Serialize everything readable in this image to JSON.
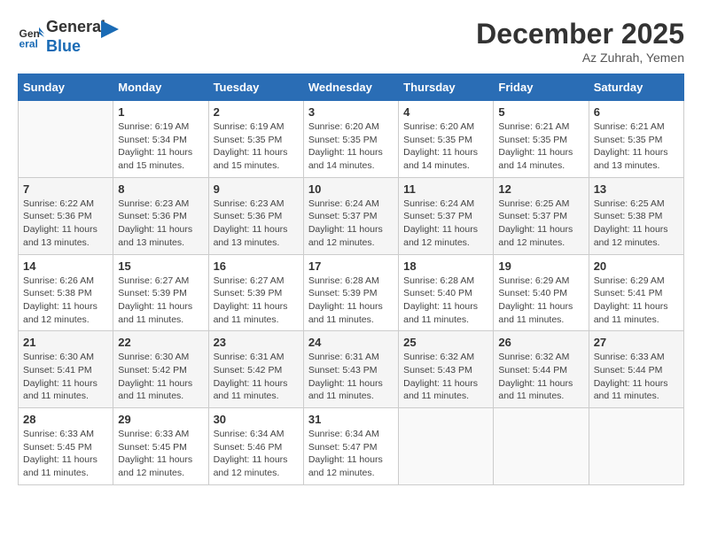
{
  "header": {
    "logo_line1": "General",
    "logo_line2": "Blue",
    "month_year": "December 2025",
    "location": "Az Zuhrah, Yemen"
  },
  "days_of_week": [
    "Sunday",
    "Monday",
    "Tuesday",
    "Wednesday",
    "Thursday",
    "Friday",
    "Saturday"
  ],
  "weeks": [
    [
      {
        "day": "",
        "info": ""
      },
      {
        "day": "1",
        "info": "Sunrise: 6:19 AM\nSunset: 5:34 PM\nDaylight: 11 hours and 15 minutes."
      },
      {
        "day": "2",
        "info": "Sunrise: 6:19 AM\nSunset: 5:35 PM\nDaylight: 11 hours and 15 minutes."
      },
      {
        "day": "3",
        "info": "Sunrise: 6:20 AM\nSunset: 5:35 PM\nDaylight: 11 hours and 14 minutes."
      },
      {
        "day": "4",
        "info": "Sunrise: 6:20 AM\nSunset: 5:35 PM\nDaylight: 11 hours and 14 minutes."
      },
      {
        "day": "5",
        "info": "Sunrise: 6:21 AM\nSunset: 5:35 PM\nDaylight: 11 hours and 14 minutes."
      },
      {
        "day": "6",
        "info": "Sunrise: 6:21 AM\nSunset: 5:35 PM\nDaylight: 11 hours and 13 minutes."
      }
    ],
    [
      {
        "day": "7",
        "info": "Sunrise: 6:22 AM\nSunset: 5:36 PM\nDaylight: 11 hours and 13 minutes."
      },
      {
        "day": "8",
        "info": "Sunrise: 6:23 AM\nSunset: 5:36 PM\nDaylight: 11 hours and 13 minutes."
      },
      {
        "day": "9",
        "info": "Sunrise: 6:23 AM\nSunset: 5:36 PM\nDaylight: 11 hours and 13 minutes."
      },
      {
        "day": "10",
        "info": "Sunrise: 6:24 AM\nSunset: 5:37 PM\nDaylight: 11 hours and 12 minutes."
      },
      {
        "day": "11",
        "info": "Sunrise: 6:24 AM\nSunset: 5:37 PM\nDaylight: 11 hours and 12 minutes."
      },
      {
        "day": "12",
        "info": "Sunrise: 6:25 AM\nSunset: 5:37 PM\nDaylight: 11 hours and 12 minutes."
      },
      {
        "day": "13",
        "info": "Sunrise: 6:25 AM\nSunset: 5:38 PM\nDaylight: 11 hours and 12 minutes."
      }
    ],
    [
      {
        "day": "14",
        "info": "Sunrise: 6:26 AM\nSunset: 5:38 PM\nDaylight: 11 hours and 12 minutes."
      },
      {
        "day": "15",
        "info": "Sunrise: 6:27 AM\nSunset: 5:39 PM\nDaylight: 11 hours and 11 minutes."
      },
      {
        "day": "16",
        "info": "Sunrise: 6:27 AM\nSunset: 5:39 PM\nDaylight: 11 hours and 11 minutes."
      },
      {
        "day": "17",
        "info": "Sunrise: 6:28 AM\nSunset: 5:39 PM\nDaylight: 11 hours and 11 minutes."
      },
      {
        "day": "18",
        "info": "Sunrise: 6:28 AM\nSunset: 5:40 PM\nDaylight: 11 hours and 11 minutes."
      },
      {
        "day": "19",
        "info": "Sunrise: 6:29 AM\nSunset: 5:40 PM\nDaylight: 11 hours and 11 minutes."
      },
      {
        "day": "20",
        "info": "Sunrise: 6:29 AM\nSunset: 5:41 PM\nDaylight: 11 hours and 11 minutes."
      }
    ],
    [
      {
        "day": "21",
        "info": "Sunrise: 6:30 AM\nSunset: 5:41 PM\nDaylight: 11 hours and 11 minutes."
      },
      {
        "day": "22",
        "info": "Sunrise: 6:30 AM\nSunset: 5:42 PM\nDaylight: 11 hours and 11 minutes."
      },
      {
        "day": "23",
        "info": "Sunrise: 6:31 AM\nSunset: 5:42 PM\nDaylight: 11 hours and 11 minutes."
      },
      {
        "day": "24",
        "info": "Sunrise: 6:31 AM\nSunset: 5:43 PM\nDaylight: 11 hours and 11 minutes."
      },
      {
        "day": "25",
        "info": "Sunrise: 6:32 AM\nSunset: 5:43 PM\nDaylight: 11 hours and 11 minutes."
      },
      {
        "day": "26",
        "info": "Sunrise: 6:32 AM\nSunset: 5:44 PM\nDaylight: 11 hours and 11 minutes."
      },
      {
        "day": "27",
        "info": "Sunrise: 6:33 AM\nSunset: 5:44 PM\nDaylight: 11 hours and 11 minutes."
      }
    ],
    [
      {
        "day": "28",
        "info": "Sunrise: 6:33 AM\nSunset: 5:45 PM\nDaylight: 11 hours and 11 minutes."
      },
      {
        "day": "29",
        "info": "Sunrise: 6:33 AM\nSunset: 5:45 PM\nDaylight: 11 hours and 12 minutes."
      },
      {
        "day": "30",
        "info": "Sunrise: 6:34 AM\nSunset: 5:46 PM\nDaylight: 11 hours and 12 minutes."
      },
      {
        "day": "31",
        "info": "Sunrise: 6:34 AM\nSunset: 5:47 PM\nDaylight: 11 hours and 12 minutes."
      },
      {
        "day": "",
        "info": ""
      },
      {
        "day": "",
        "info": ""
      },
      {
        "day": "",
        "info": ""
      }
    ]
  ]
}
